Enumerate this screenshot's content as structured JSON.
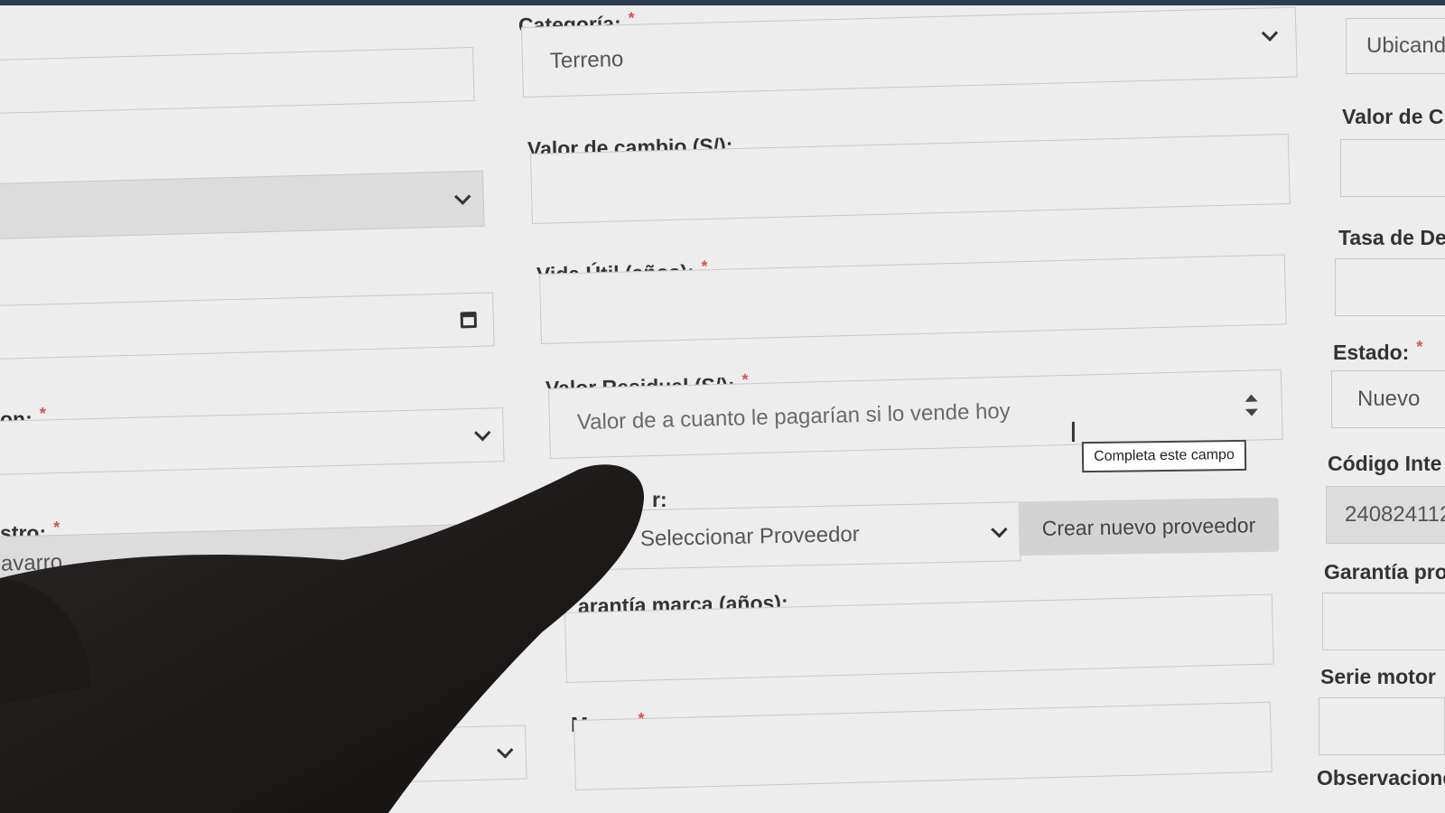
{
  "left_column": {
    "label_on": "on:",
    "label_registro": "stro:",
    "registro_value": "avarro"
  },
  "middle_column": {
    "categoria": {
      "label": "Categoría:",
      "required": "*",
      "value": "Terreno"
    },
    "valor_cambio": {
      "label": "Valor de cambio (S/):",
      "value": ""
    },
    "vida_util": {
      "label": "Vida Útil (años):",
      "required": "*",
      "value": ""
    },
    "valor_residual": {
      "label": "Valor Residual (S/):",
      "required": "*",
      "placeholder": "Valor de a cuanto le pagarían si lo vende hoy",
      "validation_tooltip": "Completa este campo"
    },
    "proveedor": {
      "label": "r:",
      "selected": "Seleccionar Proveedor",
      "create_button": "Crear nuevo proveedor"
    },
    "garantia_marca": {
      "label": "arantía marca (años):",
      "value": ""
    },
    "marca": {
      "label": "Marca",
      "required": "*",
      "value": ""
    }
  },
  "right_column": {
    "ubicacion_value": "Ubicand",
    "valor_label": "Valor de C",
    "tasa_label": "Tasa de De",
    "estado": {
      "label": "Estado:",
      "required": "*",
      "value": "Nuevo"
    },
    "codigo": {
      "label": "Código Inte",
      "value": "240824112"
    },
    "garantia_label": "Garantía pro",
    "serie_motor_label": "Serie motor",
    "observaciones_label": "Observacione"
  }
}
